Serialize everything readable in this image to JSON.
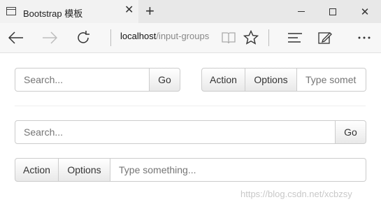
{
  "browser": {
    "tab_title": "Bootstrap 模板",
    "tab_close": "✕",
    "new_tab": "+",
    "address_host": "localhost",
    "address_path": "/input-groups",
    "icons": [
      "page-icon",
      "back-arrow-icon",
      "forward-arrow-icon",
      "refresh-icon",
      "reading-view-icon",
      "favorite-star-icon",
      "hub-icon",
      "web-note-icon",
      "more-icon"
    ]
  },
  "row1": {
    "left_group": {
      "placeholder": "Search...",
      "button": "Go"
    },
    "right_group": {
      "action": "Action",
      "options": "Options",
      "placeholder": "Type somet"
    }
  },
  "row2": {
    "placeholder": "Search...",
    "button": "Go"
  },
  "row3": {
    "action": "Action",
    "options": "Options",
    "placeholder": "Type something..."
  },
  "watermark": "https://blog.csdn.net/xcbzsy"
}
